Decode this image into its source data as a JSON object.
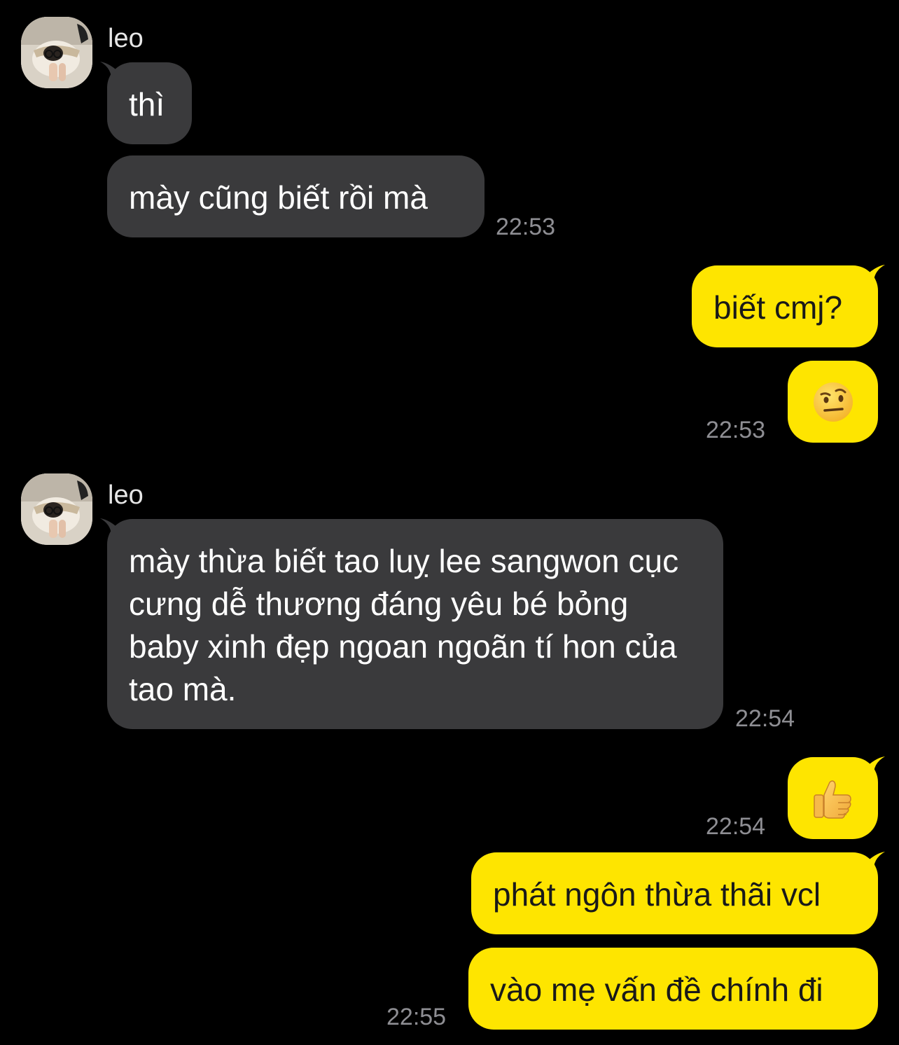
{
  "colors": {
    "background": "#000000",
    "incoming_bubble": "#3a3a3c",
    "outgoing_bubble": "#fee500",
    "timestamp": "#8e8e93"
  },
  "messages": {
    "group1": {
      "sender": "leo",
      "bubble1": "thì",
      "bubble2": "mày cũng biết rồi mà",
      "time": "22:53"
    },
    "group2": {
      "bubble1": "biết cmj?",
      "emoji": "raised-eyebrow-face-icon",
      "time": "22:53"
    },
    "group3": {
      "sender": "leo",
      "bubble1": "mày thừa biết tao luỵ lee sangwon cục cưng dễ thương đáng yêu bé bỏng baby xinh đẹp ngoan ngoãn tí hon của tao mà.",
      "time": "22:54"
    },
    "group4": {
      "emoji": "thumbs-up-icon",
      "time": "22:54"
    },
    "group5": {
      "bubble1": "phát ngôn thừa thãi vcl",
      "bubble2": "vào mẹ vấn đề chính đi",
      "time": "22:55"
    }
  }
}
